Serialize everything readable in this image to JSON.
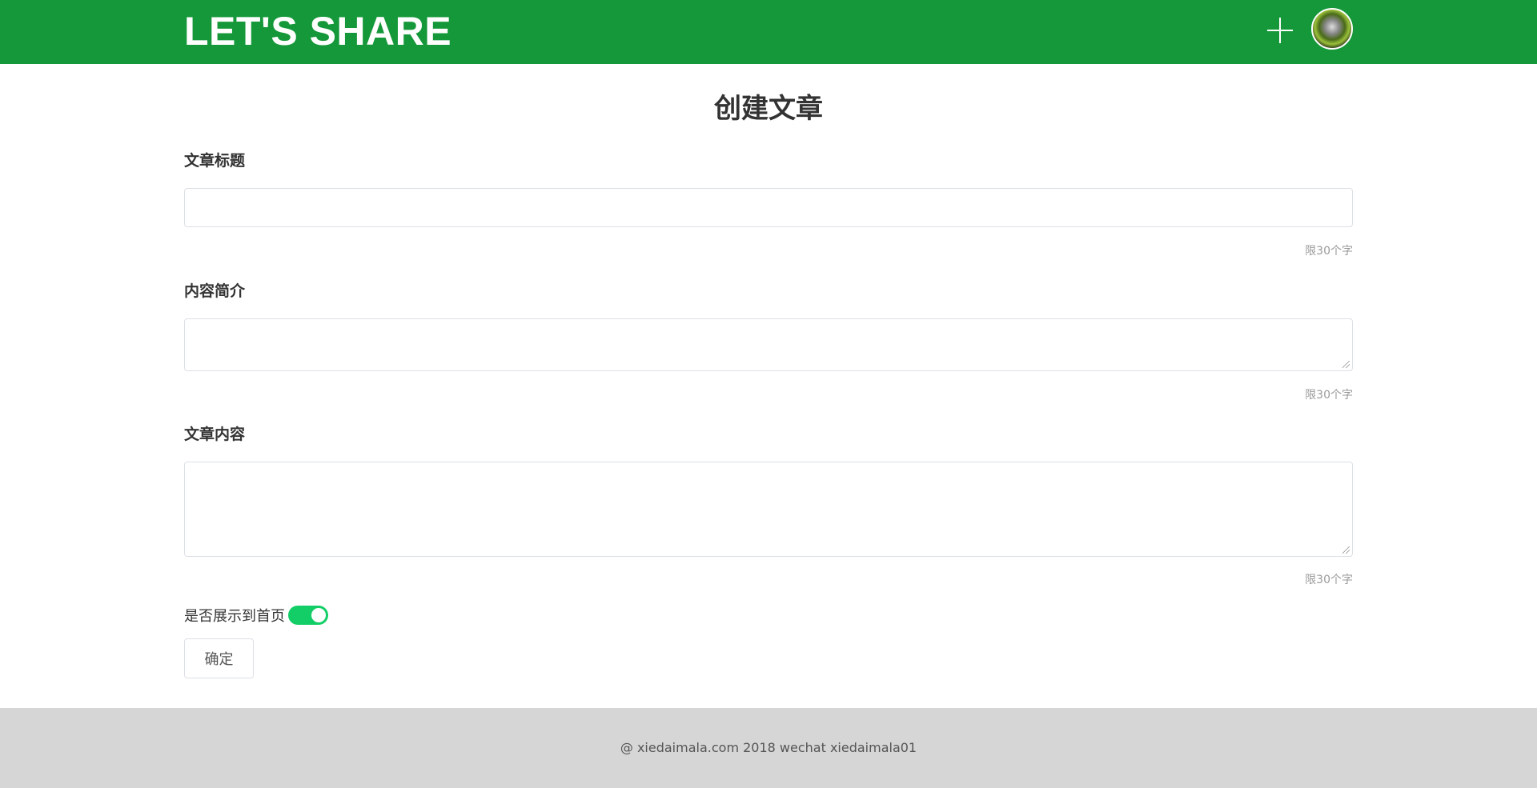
{
  "header": {
    "logo": "LET'S SHARE",
    "add_icon": "plus-icon",
    "avatar": "user-avatar"
  },
  "page_title": "创建文章",
  "form": {
    "title_label": "文章标题",
    "title_value": "",
    "title_hint": "限30个字",
    "summary_label": "内容简介",
    "summary_value": "",
    "summary_hint": "限30个字",
    "content_label": "文章内容",
    "content_value": "",
    "content_hint": "限30个字",
    "show_home_label": "是否展示到首页",
    "show_home_on": true,
    "submit_label": "确定"
  },
  "footer": {
    "text": "@ xiedaimala.com 2018 wechat xiedaimala01"
  },
  "colors": {
    "brand": "#15983a",
    "switch_on": "#13ce66"
  }
}
